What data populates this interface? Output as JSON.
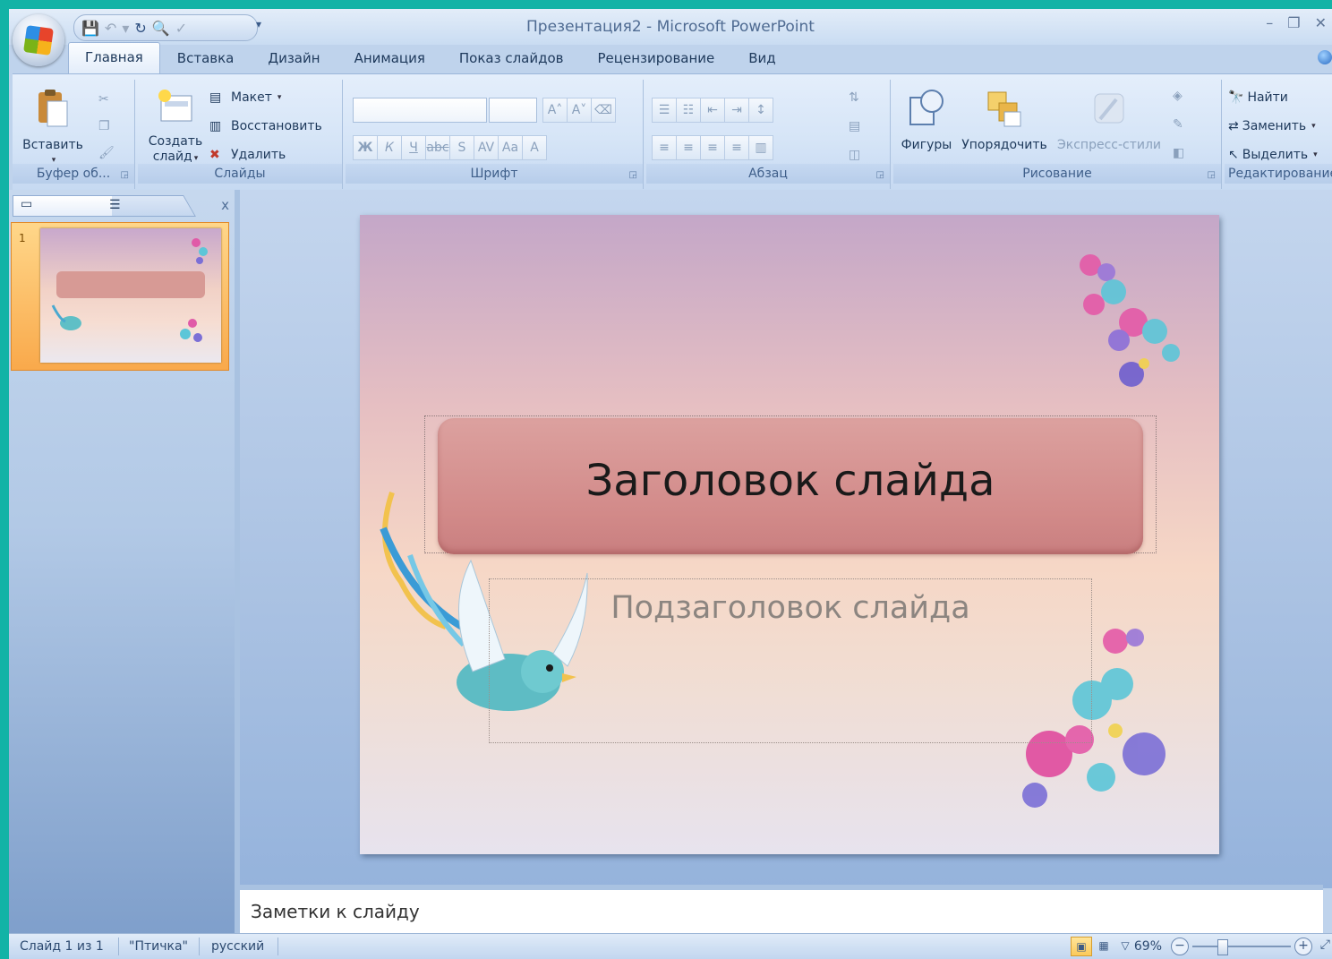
{
  "window": {
    "title": "Презентация2 - Microsoft PowerPoint",
    "controls": {
      "minimize": "–",
      "restore": "❐",
      "close": "✕"
    }
  },
  "qat": {
    "save_icon": "save-icon",
    "undo_icon": "undo-icon",
    "redo_icon": "redo-icon",
    "customize": "▾"
  },
  "tabs": [
    "Главная",
    "Вставка",
    "Дизайн",
    "Анимация",
    "Показ слайдов",
    "Рецензирование",
    "Вид"
  ],
  "ribbon": {
    "clipboard": {
      "label": "Буфер об...",
      "paste": "Вставить"
    },
    "slides": {
      "label": "Слайды",
      "new_slide_line1": "Создать",
      "new_slide_line2": "слайд",
      "layout": "Макет",
      "reset": "Восстановить",
      "delete": "Удалить"
    },
    "font": {
      "label": "Шрифт",
      "bold": "Ж",
      "italic": "К",
      "underline": "Ч",
      "strike": "abc",
      "shadow": "S",
      "spacing": "AV",
      "case": "Aa",
      "color": "A",
      "grow": "A˄",
      "shrink": "A˅"
    },
    "paragraph": {
      "label": "Абзац"
    },
    "drawing": {
      "label": "Рисование",
      "shapes": "Фигуры",
      "arrange": "Упорядочить",
      "quick_styles": "Экспресс-стили"
    },
    "editing": {
      "label": "Редактирование",
      "find": "Найти",
      "replace": "Заменить",
      "select": "Выделить"
    }
  },
  "pane": {
    "close": "x",
    "thumbnail_number": "1"
  },
  "slide": {
    "title": "Заголовок слайда",
    "subtitle": "Подзаголовок слайда"
  },
  "notes": {
    "placeholder": "Заметки к слайду"
  },
  "status": {
    "slide_info": "Слайд 1 из 1",
    "theme": "\"Птичка\"",
    "language": "русский",
    "zoom": "69%"
  },
  "colors": {
    "accent": "#f9a94b",
    "title_fill": "#d79a95",
    "ribbon_bg": "#d6e5f7",
    "frame": "#12b3a6"
  }
}
